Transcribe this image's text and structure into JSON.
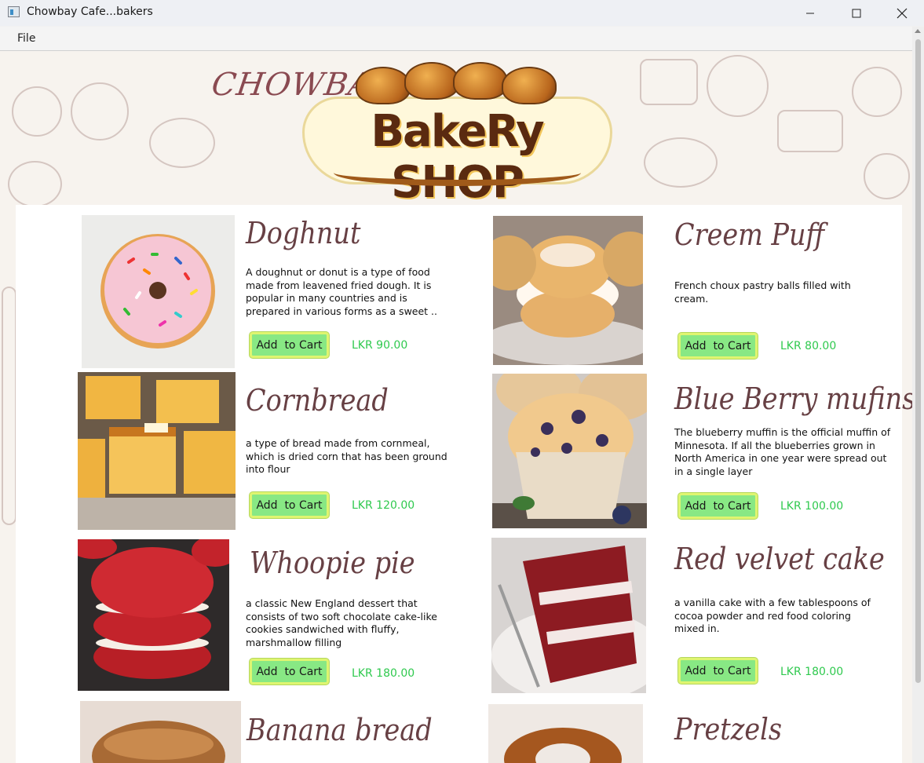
{
  "window": {
    "title": "Chowbay Cafe...bakers"
  },
  "menu": {
    "file": "File"
  },
  "brand": {
    "script": "CHOWBAY",
    "logo_text": "BakeRy SHOP"
  },
  "products": [
    {
      "name": "Doghnut",
      "description": "A doughnut or donut is a type of food made from leavened fried dough. It is popular in many countries and is prepared in various forms as a sweet ..",
      "button": "Add  to Cart",
      "price": "LKR 90.00"
    },
    {
      "name": "Creem Puff",
      "description": "French choux pastry balls filled with cream.",
      "button": "Add  to Cart",
      "price": "LKR 80.00"
    },
    {
      "name": "Cornbread",
      "description": "a type of bread made from cornmeal, which is dried corn that has been ground into flour",
      "button": "Add  to Cart",
      "price": "LKR 120.00"
    },
    {
      "name": "Blue Berry  mufins",
      "description": "The blueberry muffin is the official muffin of Minnesota. If all the blueberries grown in North America in one year were spread out in a single layer",
      "button": "Add  to Cart",
      "price": "LKR 100.00"
    },
    {
      "name": "Whoopie pie",
      "description": "a classic New England dessert that consists of two soft chocolate cake-like cookies sandwiched with fluffy, marshmallow filling",
      "button": "Add  to Cart",
      "price": "LKR 180.00"
    },
    {
      "name": "Red velvet cake",
      "description": "a vanilla cake with a few tablespoons of cocoa powder and red food coloring mixed in.",
      "button": "Add  to Cart",
      "price": "LKR 180.00"
    },
    {
      "name": "Banana bread"
    },
    {
      "name": "Pretzels"
    }
  ]
}
